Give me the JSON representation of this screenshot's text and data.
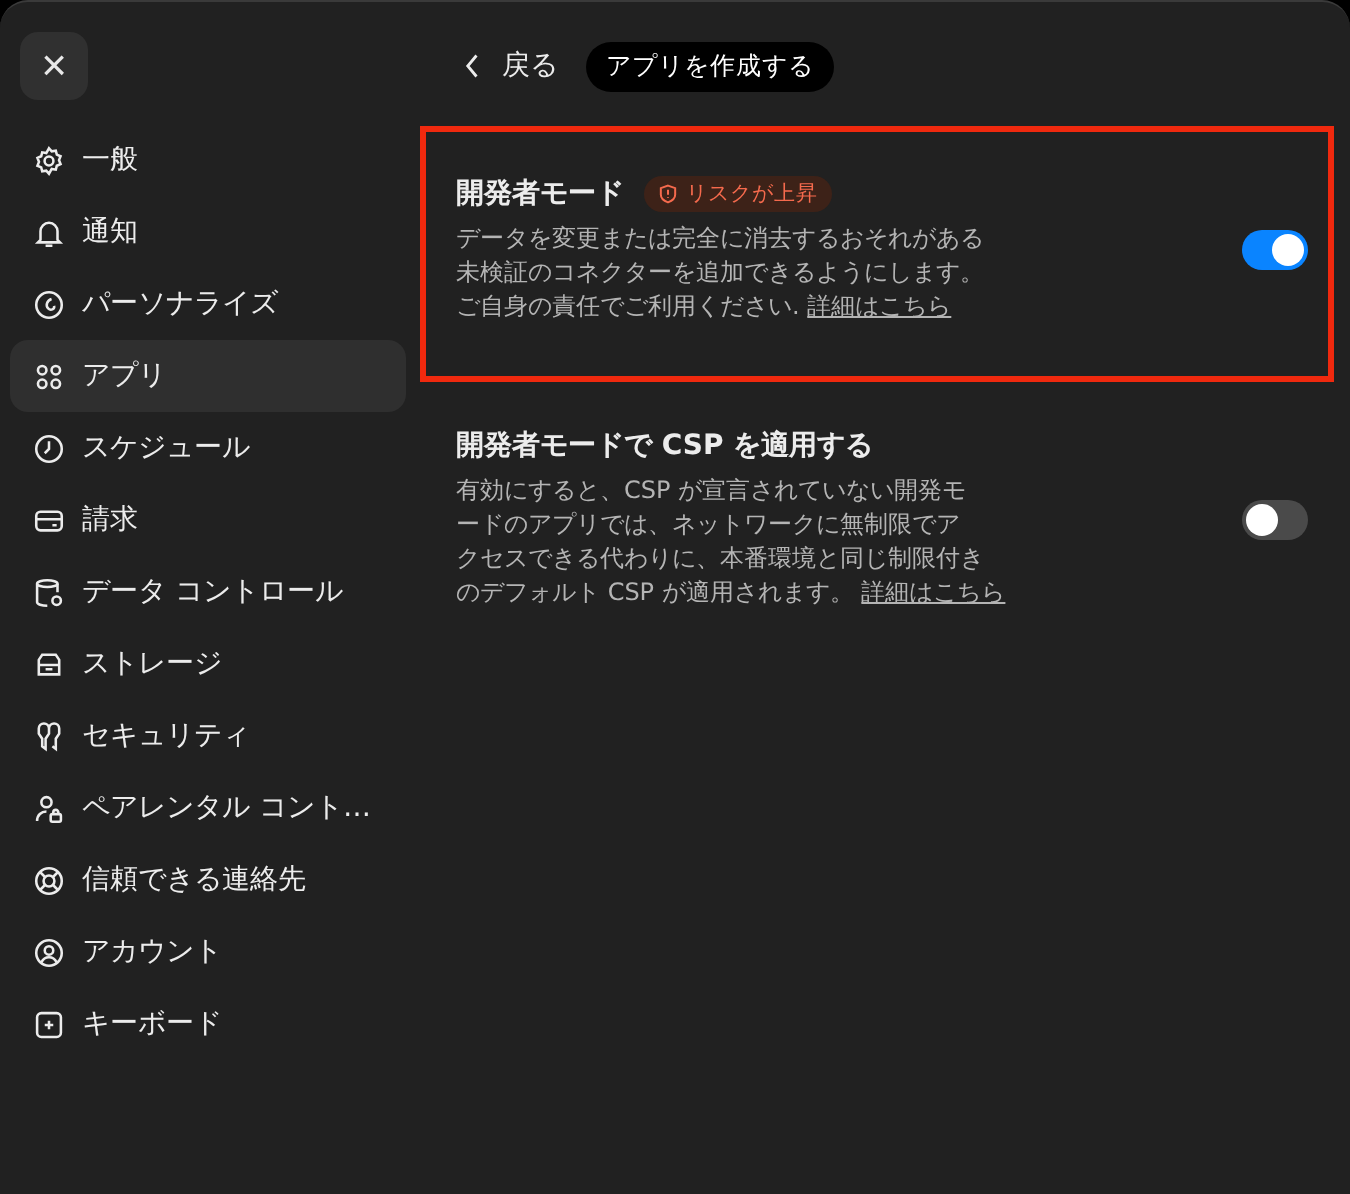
{
  "close_button": {
    "label": "×"
  },
  "sidebar": {
    "items": [
      {
        "label": "一般",
        "selected": false
      },
      {
        "label": "通知",
        "selected": false
      },
      {
        "label": "パーソナライズ",
        "selected": false
      },
      {
        "label": "アプリ",
        "selected": true
      },
      {
        "label": "スケジュール",
        "selected": false
      },
      {
        "label": "請求",
        "selected": false
      },
      {
        "label": "データ コントロール",
        "selected": false
      },
      {
        "label": "ストレージ",
        "selected": false
      },
      {
        "label": "セキュリティ",
        "selected": false
      },
      {
        "label": "ペアレンタル コント…",
        "selected": false
      },
      {
        "label": "信頼できる連絡先",
        "selected": false
      },
      {
        "label": "アカウント",
        "selected": false
      },
      {
        "label": "キーボード",
        "selected": false
      }
    ]
  },
  "header": {
    "back": "戻る",
    "create_app": "アプリを作成する"
  },
  "settings": [
    {
      "title": "開発者モード",
      "badge": "リスクが上昇",
      "highlighted": true,
      "on": true,
      "description": [
        "データを変更または完全に消去するおそれがある",
        "未検証のコネクターを追加できるようにします。",
        "ご自身の責任でご利用ください."
      ],
      "link": "詳細はこちら"
    },
    {
      "title": "開発者モードで CSP を適用する",
      "highlighted": false,
      "on": false,
      "description": [
        "有効にすると、CSP が宣言されていない開発モ",
        "ードのアプリでは、ネットワークに無制限でア",
        "クセスできる代わりに、本番環境と同じ制限付き",
        "のデフォルト CSP が適用されます。"
      ],
      "link": "詳細はこちら"
    }
  ]
}
